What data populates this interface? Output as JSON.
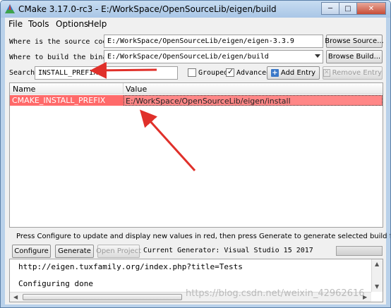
{
  "window": {
    "title": "CMake 3.17.0-rc3 - E:/WorkSpace/OpenSourceLib/eigen/build",
    "controls": [
      "minimize",
      "maximize",
      "close"
    ]
  },
  "menu": [
    "File",
    "Tools",
    "Options",
    "Help"
  ],
  "source": {
    "label": "Where is the source code:",
    "value": "E:/WorkSpace/OpenSourceLib/eigen/eigen-3.3.9",
    "button": "Browse Source..."
  },
  "build": {
    "label": "Where to build the binaries:",
    "value": "E:/WorkSpace/OpenSourceLib/eigen/build",
    "button": "Browse Build..."
  },
  "search": {
    "label": "Search:",
    "value": "INSTALL_PREFIX",
    "grouped_label": "Grouped",
    "grouped_checked": false,
    "advanced_label": "Advanced",
    "advanced_checked": true,
    "add_entry": "Add Entry",
    "remove_entry": "Remove Entry"
  },
  "table": {
    "columns": [
      "Name",
      "Value"
    ],
    "rows": [
      {
        "name": "CMAKE_INSTALL_PREFIX",
        "value": "E:/WorkSpace/OpenSourceLib/eigen/install"
      }
    ],
    "highlight_color": "#ff6a6a"
  },
  "hint": "Press Configure to update and display new values in red, then press Generate to generate selected build files.",
  "actions": {
    "configure": "Configure",
    "generate": "Generate",
    "open_project": "Open Project",
    "generator": "Current Generator: Visual Studio 15 2017"
  },
  "log": [
    "http://eigen.tuxfamily.org/index.php?title=Tests",
    "",
    "Configuring done"
  ],
  "watermark": "https://blog.csdn.net/weixin_42962616",
  "annotation_color": "#e0302a"
}
